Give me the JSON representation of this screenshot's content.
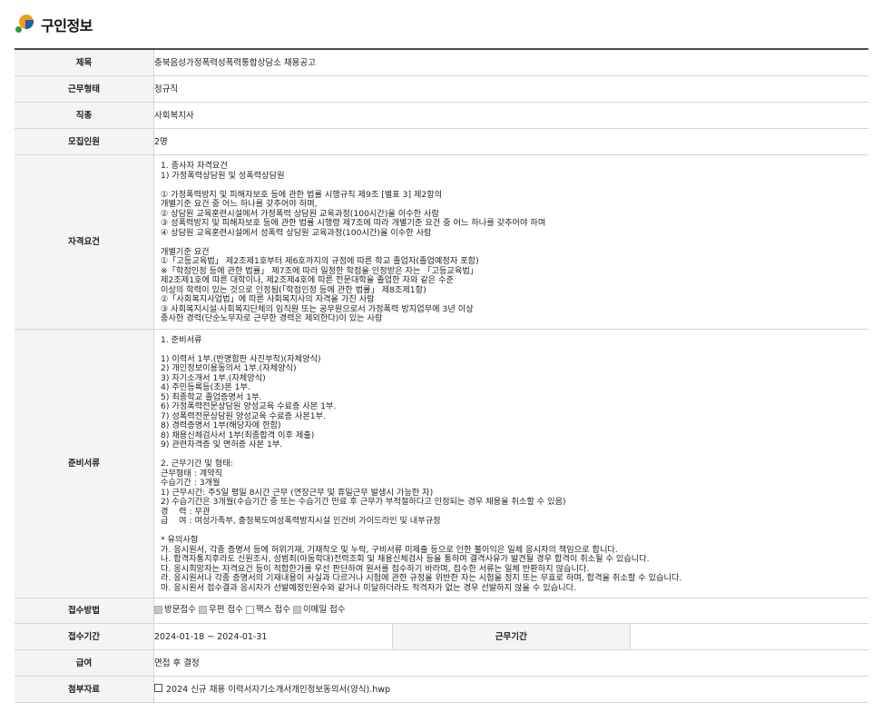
{
  "section_title": "구인정보",
  "rows": {
    "title": {
      "label": "제목",
      "value": "충북음성가정폭력성폭력통합상담소 채용공고"
    },
    "work_type": {
      "label": "근무형태",
      "value": "정규직"
    },
    "job_category": {
      "label": "직종",
      "value": "사회복지사"
    },
    "headcount": {
      "label": "모집인원",
      "value": "2명"
    },
    "qualifications": {
      "label": "자격요건",
      "lines": [
        "1. 종사자 자격요건",
        "1) 가정폭력상담원 및 성폭력상담원",
        "",
        "① 가정폭력방지 및 피해자보호 등에 관한 법률 시행규칙 제9조 [별표 3] 제2항의",
        "개별기준 요건 중 어느 하나를 갖추어야 하며,",
        "② 상담원 교육훈련시설에서 가정폭력 상담원 교육과정(100시간)을 이수한 사람",
        "③ 성폭력방지 및 피해자보호 등에 관한 법률 시행령 제7조에 따라 개별기준 요건 중 어느 하나를 갖추어야 하며",
        "④ 상담원 교육훈련시설에서 성폭력 상담원 교육과정(100시간)을 이수한 사람",
        "",
        "개별기준 요건",
        "①「고등교육법」 제2조제1호부터 제6호까지의 규정에 따른 학교 졸업자(졸업예정자 포함)",
        "※「학점인정 등에 관한 법률」 제7조에 따라 일정한 학점을 인정받은 자는 「고등교육법」",
        "제2조제1호에 따른 대학이나, 제2조제4호에 따른 전문대학을 졸업한 자와 같은 수준",
        "이상의 학력이 있는 것으로 인정됨(「학점인정 등에 관한 법률」 제8조제1항)",
        "②「사회복지사업법」에 따른 사회복지사의 자격을 가진 사람",
        "③ 사회복지시설·사회복지단체의 임직원 또는 공무원으로서 가정폭력 방지업무에 3년 이상",
        "종사한 경력(단순노무자로 근무한 경력은 제외한다)이 있는 사람"
      ]
    },
    "documents": {
      "label": "준비서류",
      "lines": [
        "1. 준비서류",
        "",
        "1) 이력서 1부.(반명함판 사진부착)(자체양식)",
        "2) 개인정보이용동의서 1부.(자체양식)",
        "3) 자기소개서 1부.(자체양식)",
        "4) 주민등록등(초)본 1부.",
        "5) 최종학교 졸업증명서 1부.",
        "6) 가정폭력전문상담원 양성교육 수료증 사본 1부.",
        "7) 성폭력전문상담원 양성교육 수료증 사본1부.",
        "8) 경력증명서 1부(해당자에 한함)",
        "8) 채용신체검사서 1부(최종합격 이후 제출)",
        "9) 관련자격증 및 면허증 사본 1부.",
        "",
        "2. 근무기간 및 형태:",
        "근무형태 : 계약직",
        "수습기간 : 3개월",
        "1) 근무시간: 주5일 평일 8시간 근무 (연장근무 및 휴일근무 발생시 가능한 자)",
        "2) 수습기간은 3개월(수습기간 중 또는 수습기간 만료 후 근무가 부적절하다고 인정되는 경우 채용을 취소할 수 있음)",
        "경    력 : 무관",
        "급    여 : 여성가족부, 충청북도여성폭력방지시설 인건비 가이드라인 및 내부규정",
        "",
        "* 유의사항",
        "가. 응시원서, 각종 증명서 등에 허위기재, 기재착오 및 누락, 구비서류 미제출 등으로 인한 불이익은 일체 응시자의 책임으로 합니다.",
        "나. 합격자통지후라도 신원조사, 성범죄(아동학대)전력조회 및 채용신체검사 등을 통하여 결격사유가 발견될 경우 합격이 취소될 수 있습니다.",
        "다. 응시희망자는 자격요건 등이 적합한가를 우선 판단하여 원서를 접수하기 바라며, 접수한 서류는 일체 반환하지 않습니다.",
        "라. 응시원서나 각종 증명서의 기재내용이 사실과 다르거나 시험에 관한 규정을 위반한 자는 시험을 정지 또는 무효로 하며, 합격을 취소할 수 있습니다.",
        "마. 응시원서 접수결과 응시자가 선발예정인원수와 같거나 미달하더라도 적격자가 없는 경우 선발하지 않을 수 있습니다."
      ]
    },
    "apply_method": {
      "label": "접수방법",
      "options": [
        {
          "label": "방문접수",
          "checked": true
        },
        {
          "label": "우편 접수",
          "checked": true
        },
        {
          "label": "팩스 접수",
          "checked": false
        },
        {
          "label": "이메일 접수",
          "checked": true
        }
      ]
    },
    "apply_period": {
      "label": "접수기간",
      "value": "2024-01-18 ~ 2024-01-31",
      "work_period_label": "근무기간",
      "work_period_value": ""
    },
    "salary": {
      "label": "급여",
      "value": "면접 후 결정"
    },
    "attachment": {
      "label": "첨부자료",
      "value": "2024 신규 채용 이력서자기소개서개인정보동의서(양식).hwp"
    }
  },
  "colors": {
    "header_bg": "#f4f4f4",
    "border": "#d6d6d6",
    "top_border": "#4a4a4a"
  }
}
